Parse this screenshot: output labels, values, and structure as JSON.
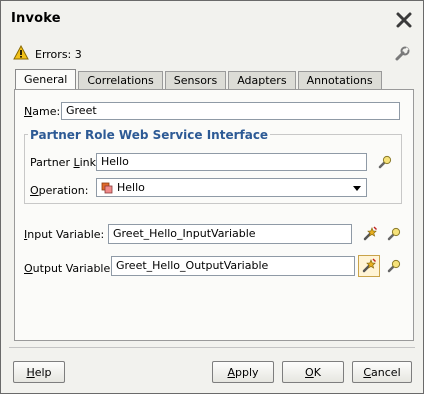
{
  "window": {
    "title": "Invoke"
  },
  "errors": {
    "text": "Errors: 3"
  },
  "tabs": [
    {
      "label": "General",
      "active": true
    },
    {
      "label": "Correlations",
      "active": false
    },
    {
      "label": "Sensors",
      "active": false
    },
    {
      "label": "Adapters",
      "active": false
    },
    {
      "label": "Annotations",
      "active": false
    }
  ],
  "general": {
    "name_label_first": "N",
    "name_label_rest": "ame:",
    "name_value": "Greet",
    "group_title": "Partner Role Web Service Interface",
    "partner_link_label_pre": "Partner ",
    "partner_link_label_ul": "L",
    "partner_link_label_post": "ink:",
    "partner_link_value": "Hello",
    "operation_label_pre": "O",
    "operation_label_rest": "peration:",
    "operation_value": "Hello",
    "input_label_first": "I",
    "input_label_rest": "nput Variable:",
    "input_value": "Greet_Hello_InputVariable",
    "output_label_first": "O",
    "output_label_rest": "utput Variable:",
    "output_value": "Greet_Hello_OutputVariable"
  },
  "buttons": {
    "help_first": "H",
    "help_rest": "elp",
    "apply_first": "A",
    "apply_rest": "pply",
    "ok_first": "O",
    "ok_rest": "K",
    "cancel_first": "C",
    "cancel_rest": "ancel"
  },
  "colors": {
    "group_title": "#2d5a95",
    "warning": "#f2c21a",
    "accent_border": "#c9a34a"
  }
}
